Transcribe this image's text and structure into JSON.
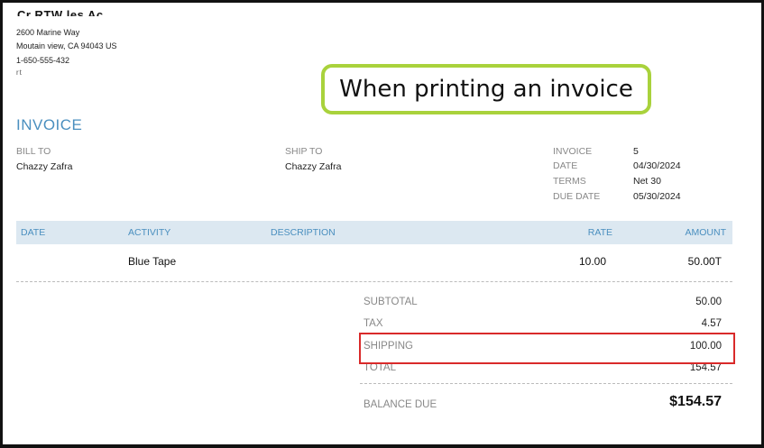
{
  "company": {
    "name": "Cr RTW les Ac",
    "address_line1": "2600 Marine Way",
    "address_line2": "Moutain view, CA  94043 US",
    "phone": "1-650-555-432",
    "email": "rt"
  },
  "callout": {
    "text": "When printing an invoice",
    "border_color": "#a9d23c"
  },
  "invoice": {
    "title": "INVOICE",
    "bill_to_label": "BILL TO",
    "bill_to": "Chazzy Zafra",
    "ship_to_label": "SHIP TO",
    "ship_to": "Chazzy Zafra",
    "meta": [
      {
        "label": "INVOICE",
        "value": "5"
      },
      {
        "label": "DATE",
        "value": "04/30/2024"
      },
      {
        "label": "TERMS",
        "value": "Net 30"
      },
      {
        "label": "DUE DATE",
        "value": "05/30/2024"
      }
    ]
  },
  "table": {
    "headers": {
      "date": "DATE",
      "activity": "ACTIVITY",
      "description": "DESCRIPTION",
      "rate": "RATE",
      "amount": "AMOUNT"
    },
    "rows": [
      {
        "date": "",
        "activity": "Blue Tape",
        "description": "",
        "rate": "10.00",
        "amount": "50.00T"
      }
    ]
  },
  "totals": {
    "subtotal_label": "SUBTOTAL",
    "subtotal": "50.00",
    "tax_label": "TAX",
    "tax": "4.57",
    "shipping_label": "SHIPPING",
    "shipping": "100.00",
    "total_label": "TOTAL",
    "total": "154.57",
    "balance_label": "BALANCE DUE",
    "balance": "$154.57"
  },
  "colors": {
    "accent": "#4a8fbf",
    "header_bg": "#dce8f1",
    "highlight": "#d92a2a"
  }
}
